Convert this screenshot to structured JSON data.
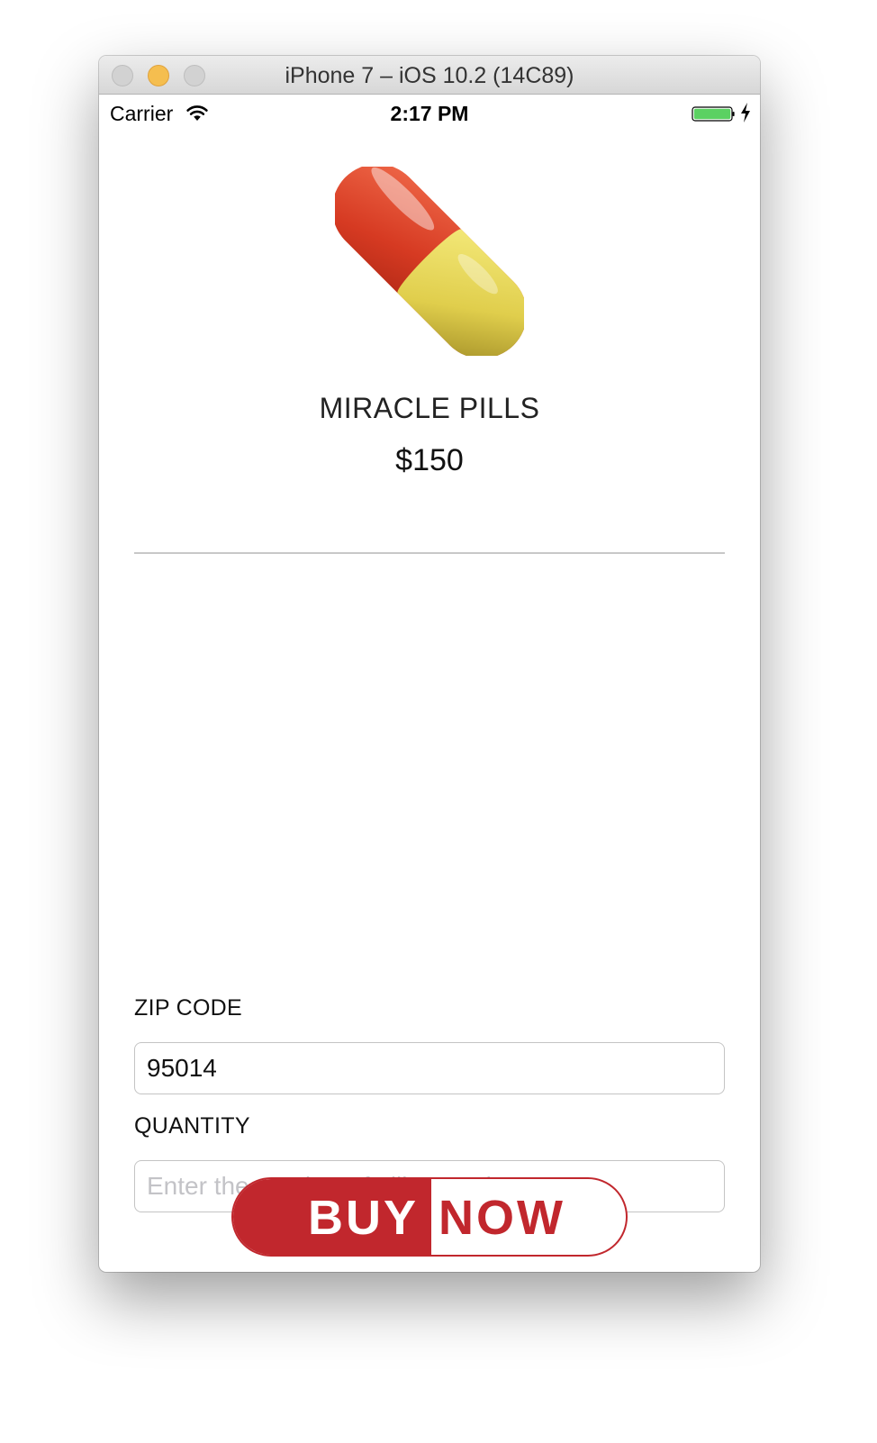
{
  "window": {
    "title": "iPhone 7 – iOS 10.2 (14C89)"
  },
  "status_bar": {
    "carrier": "Carrier",
    "time": "2:17 PM",
    "icons": [
      "wifi-icon",
      "battery-icon",
      "charging-bolt-icon"
    ]
  },
  "product": {
    "image": "pill-icon",
    "name": "MIRACLE PILLS",
    "price": "$150"
  },
  "form": {
    "zip_label": "ZIP CODE",
    "zip_value": "95014",
    "quantity_label": "QUANTITY",
    "quantity_value": "",
    "quantity_placeholder": "Enter the number of pills to order..."
  },
  "buy_button": {
    "left_text": "BUY",
    "right_text": "NOW"
  },
  "colors": {
    "accent": "#c1272d",
    "pill_red": "#d63a22",
    "pill_yellow": "#e3d14e",
    "battery_green": "#5bd162"
  }
}
